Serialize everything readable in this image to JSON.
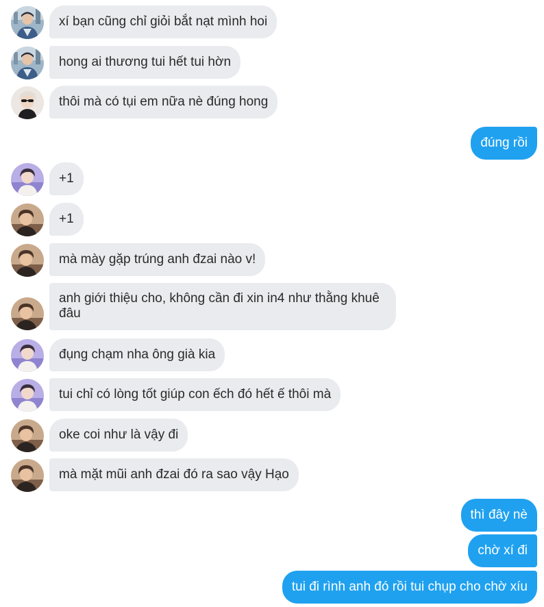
{
  "colors": {
    "incoming_bubble": "#e9ebee",
    "outgoing_bubble": "#1fa1f0",
    "incoming_text": "#2a2a2a",
    "outgoing_text": "#ffffff"
  },
  "messages": [
    {
      "direction": "in",
      "avatar": "avatar-city-boy-icon",
      "text": "xí bạn cũng chỉ giỏi bắt nạt mình hoi"
    },
    {
      "direction": "in",
      "avatar": "avatar-city-boy-icon",
      "text": "hong ai thương tui hết tui hờn"
    },
    {
      "direction": "in",
      "avatar": "avatar-blond-boy-icon",
      "text": "thôi mà có tụi em nữa nè đúng hong"
    },
    {
      "direction": "out",
      "text": "đúng rồi"
    },
    {
      "direction": "in",
      "avatar": "avatar-purple-boy-icon",
      "text": "+1"
    },
    {
      "direction": "in",
      "avatar": "avatar-warm-boy-icon",
      "text": "+1"
    },
    {
      "direction": "in",
      "avatar": "avatar-warm-boy-icon",
      "text": "mà mày gặp trúng anh đzai nào v!"
    },
    {
      "direction": "in",
      "avatar": "avatar-warm-boy-icon",
      "text": "anh giới thiệu cho, không cần đi xin in4 như thằng khuê đâu"
    },
    {
      "direction": "in",
      "avatar": "avatar-purple-boy-icon",
      "text": "đụng chạm nha ông già kia"
    },
    {
      "direction": "in",
      "avatar": "avatar-purple-boy-icon",
      "text": "tui chỉ có lòng tốt giúp con ếch đó hết ế thôi mà"
    },
    {
      "direction": "in",
      "avatar": "avatar-warm-boy-icon",
      "text": "oke coi như là vậy đi"
    },
    {
      "direction": "in",
      "avatar": "avatar-warm-boy-icon",
      "text": "mà mặt mũi anh đzai đó ra sao vậy Hạo"
    },
    {
      "direction": "out",
      "text": "thì đây nè"
    },
    {
      "direction": "out",
      "text": "chờ xí đi"
    },
    {
      "direction": "out",
      "text": "tui đi rình anh đó rồi tui chụp cho chờ xíu"
    }
  ]
}
